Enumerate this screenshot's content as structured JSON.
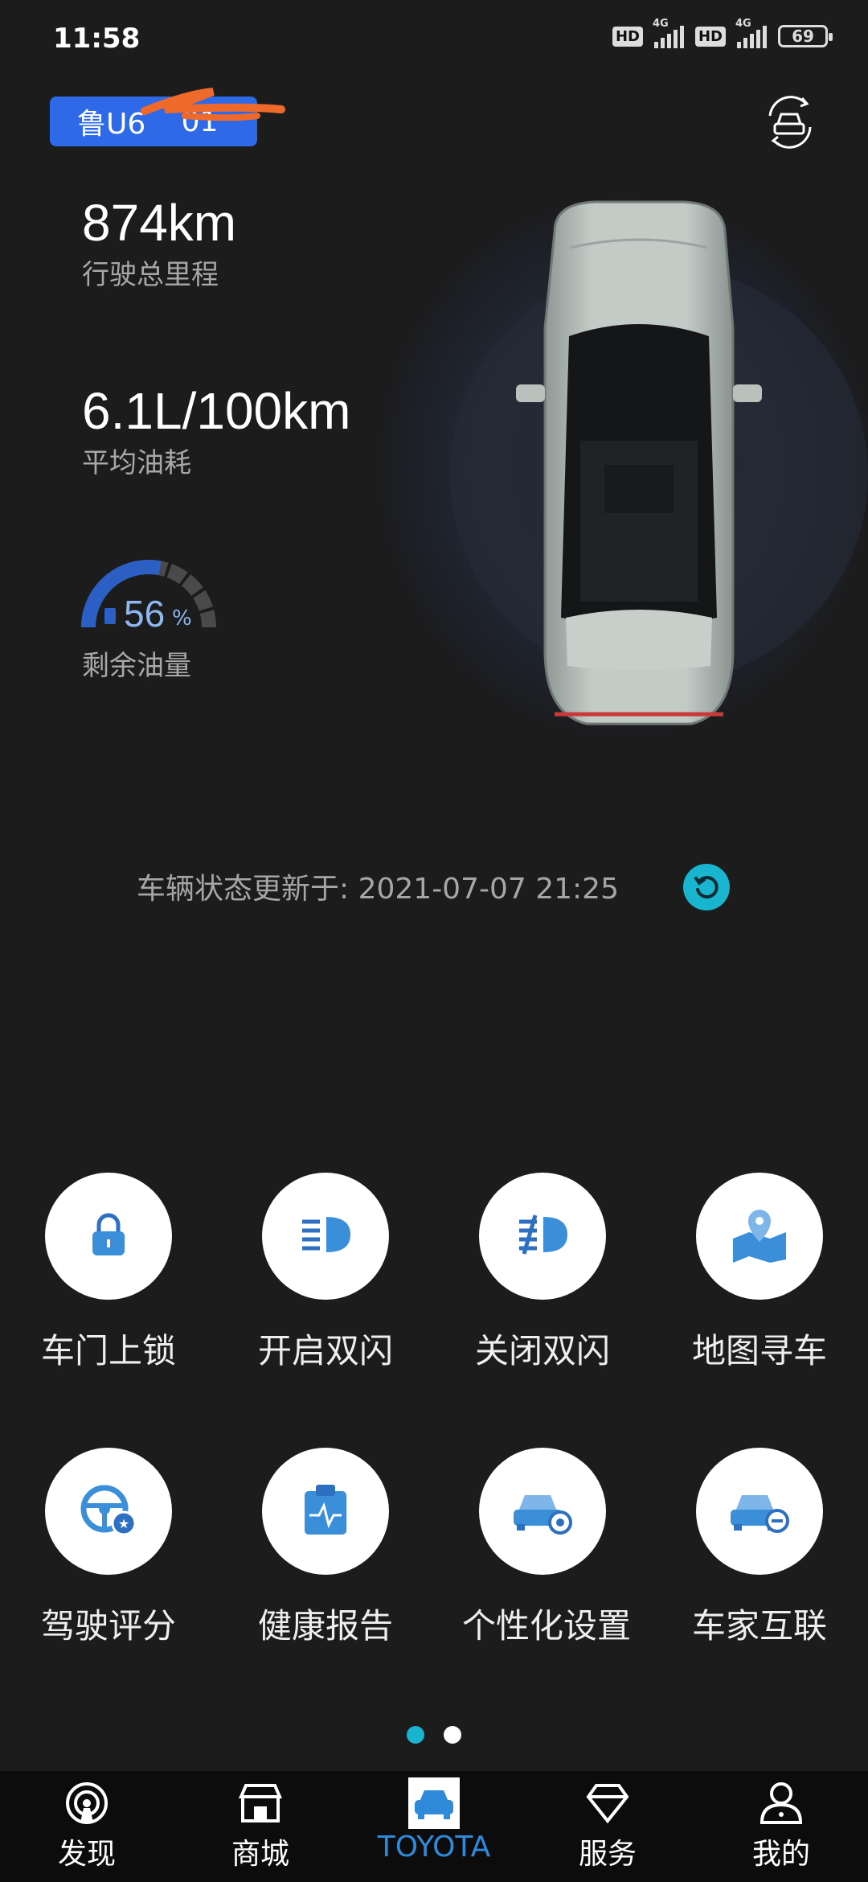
{
  "status_bar": {
    "time": "11:58",
    "battery": "69",
    "hd1": "HD",
    "hd2": "HD",
    "net1": "4G",
    "net2": "4G"
  },
  "vehicle": {
    "plate": "鲁U6",
    "plate_tail": "01",
    "mileage_value": "874km",
    "mileage_label": "行驶总里程",
    "fuel_consumption_value": "6.1L/100km",
    "fuel_consumption_label": "平均油耗",
    "fuel_level_value": "56",
    "fuel_level_unit": "%",
    "fuel_level_fraction": 0.56,
    "fuel_level_label": "剩余油量"
  },
  "update_status": "车辆状态更新于: 2021-07-07 21:25",
  "actions": [
    {
      "label": "车门上锁",
      "icon": "lock-icon"
    },
    {
      "label": "开启双闪",
      "icon": "headlight-on-icon"
    },
    {
      "label": "关闭双闪",
      "icon": "headlight-off-icon"
    },
    {
      "label": "地图寻车",
      "icon": "map-pin-icon"
    },
    {
      "label": "驾驶评分",
      "icon": "steering-wheel-icon"
    },
    {
      "label": "健康报告",
      "icon": "health-report-icon"
    },
    {
      "label": "个性化设置",
      "icon": "car-settings-icon"
    },
    {
      "label": "车家互联",
      "icon": "car-link-icon"
    }
  ],
  "page_indicator": {
    "pages": 2,
    "current": 1
  },
  "colors": {
    "accent": "#19b5cf",
    "plate": "#2e6ae8",
    "tab_active": "#2f8ad9",
    "icon_blue": "#3a8fd8"
  },
  "tabs": [
    {
      "label": "发现",
      "icon": "discover-icon"
    },
    {
      "label": "商城",
      "icon": "store-icon"
    },
    {
      "label": "TOYOTA",
      "icon": "car-icon",
      "active": true
    },
    {
      "label": "服务",
      "icon": "diamond-icon"
    },
    {
      "label": "我的",
      "icon": "profile-icon"
    }
  ]
}
